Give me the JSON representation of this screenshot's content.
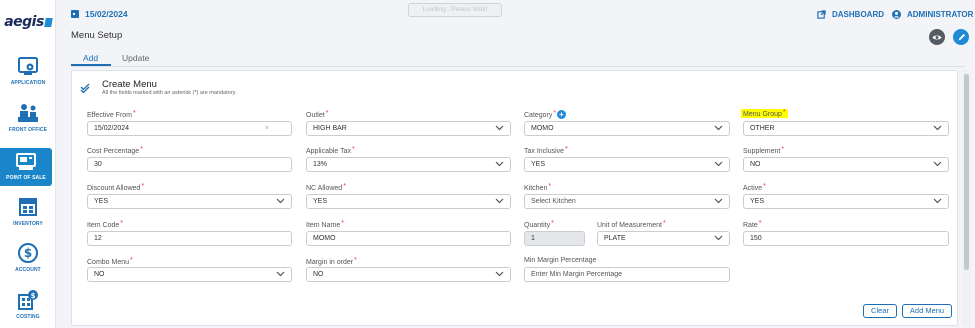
{
  "brand": {
    "name": "aegis"
  },
  "sidebar": {
    "items": [
      {
        "label": "APPLICATION",
        "icon": "application-gear-icon"
      },
      {
        "label": "FRONT OFFICE",
        "icon": "front-office-icon"
      },
      {
        "label": "POINT OF SALE",
        "icon": "point-of-sale-icon",
        "active": true
      },
      {
        "label": "INVENTORY",
        "icon": "inventory-icon"
      },
      {
        "label": "ACCOUNT",
        "icon": "account-dollar-icon"
      },
      {
        "label": "COSTING",
        "icon": "costing-icon"
      }
    ]
  },
  "header": {
    "date": "15/02/2024",
    "loading": "Loading . Please Wait!",
    "dashboard": "DASHBOARD",
    "user": "ADMINISTRATOR"
  },
  "page": {
    "title": "Menu Setup",
    "tabs": [
      {
        "label": "Add",
        "active": true
      },
      {
        "label": "Update"
      }
    ]
  },
  "card": {
    "title": "Create Menu",
    "subtitle": "All the fields marked with an asterisk (*) are mandatory."
  },
  "form": {
    "effective_from": {
      "label": "Effective From",
      "value": "15/02/2024",
      "clear": "×"
    },
    "outlet": {
      "label": "Outlet",
      "value": "HIGH BAR"
    },
    "category": {
      "label": "Category",
      "value": "MOMO"
    },
    "menu_group": {
      "label": "Menu Group",
      "value": "OTHER"
    },
    "cost_percentage": {
      "label": "Cost Percentage",
      "value": "30"
    },
    "applicable_tax": {
      "label": "Applicable Tax",
      "value": "13%"
    },
    "tax_inclusive": {
      "label": "Tax Inclusive",
      "value": "YES"
    },
    "supplement": {
      "label": "Supplement",
      "value": "NO"
    },
    "discount_allowed": {
      "label": "Discount Allowed",
      "value": "YES"
    },
    "nc_allowed": {
      "label": "NC Allowed",
      "value": "YES"
    },
    "kitchen": {
      "label": "Kitchen",
      "value": "Select Kitchen"
    },
    "active": {
      "label": "Active",
      "value": "YES"
    },
    "item_code": {
      "label": "Item Code",
      "value": "12"
    },
    "item_name": {
      "label": "Item Name",
      "value": "MOMO"
    },
    "quantity": {
      "label": "Quantity",
      "value": "1"
    },
    "unit_of_measurement": {
      "label": "Unit of Measurement",
      "value": "PLATE"
    },
    "rate": {
      "label": "Rate",
      "value": "150"
    },
    "combo_menu": {
      "label": "Combo Menu",
      "value": "NO"
    },
    "margin_in_order": {
      "label": "Margin in order",
      "value": "NO"
    },
    "min_margin_percentage": {
      "label": "Min Margin Percentage",
      "placeholder": "Enter Min Margin Percentage"
    },
    "asterisk": "*"
  },
  "buttons": {
    "clear": "Clear",
    "add_menu": "Add Menu"
  },
  "colors": {
    "accent": "#1f6fb5",
    "active_nav": "#1a85c9",
    "highlight": "#ffff00",
    "required": "#ee3333"
  }
}
